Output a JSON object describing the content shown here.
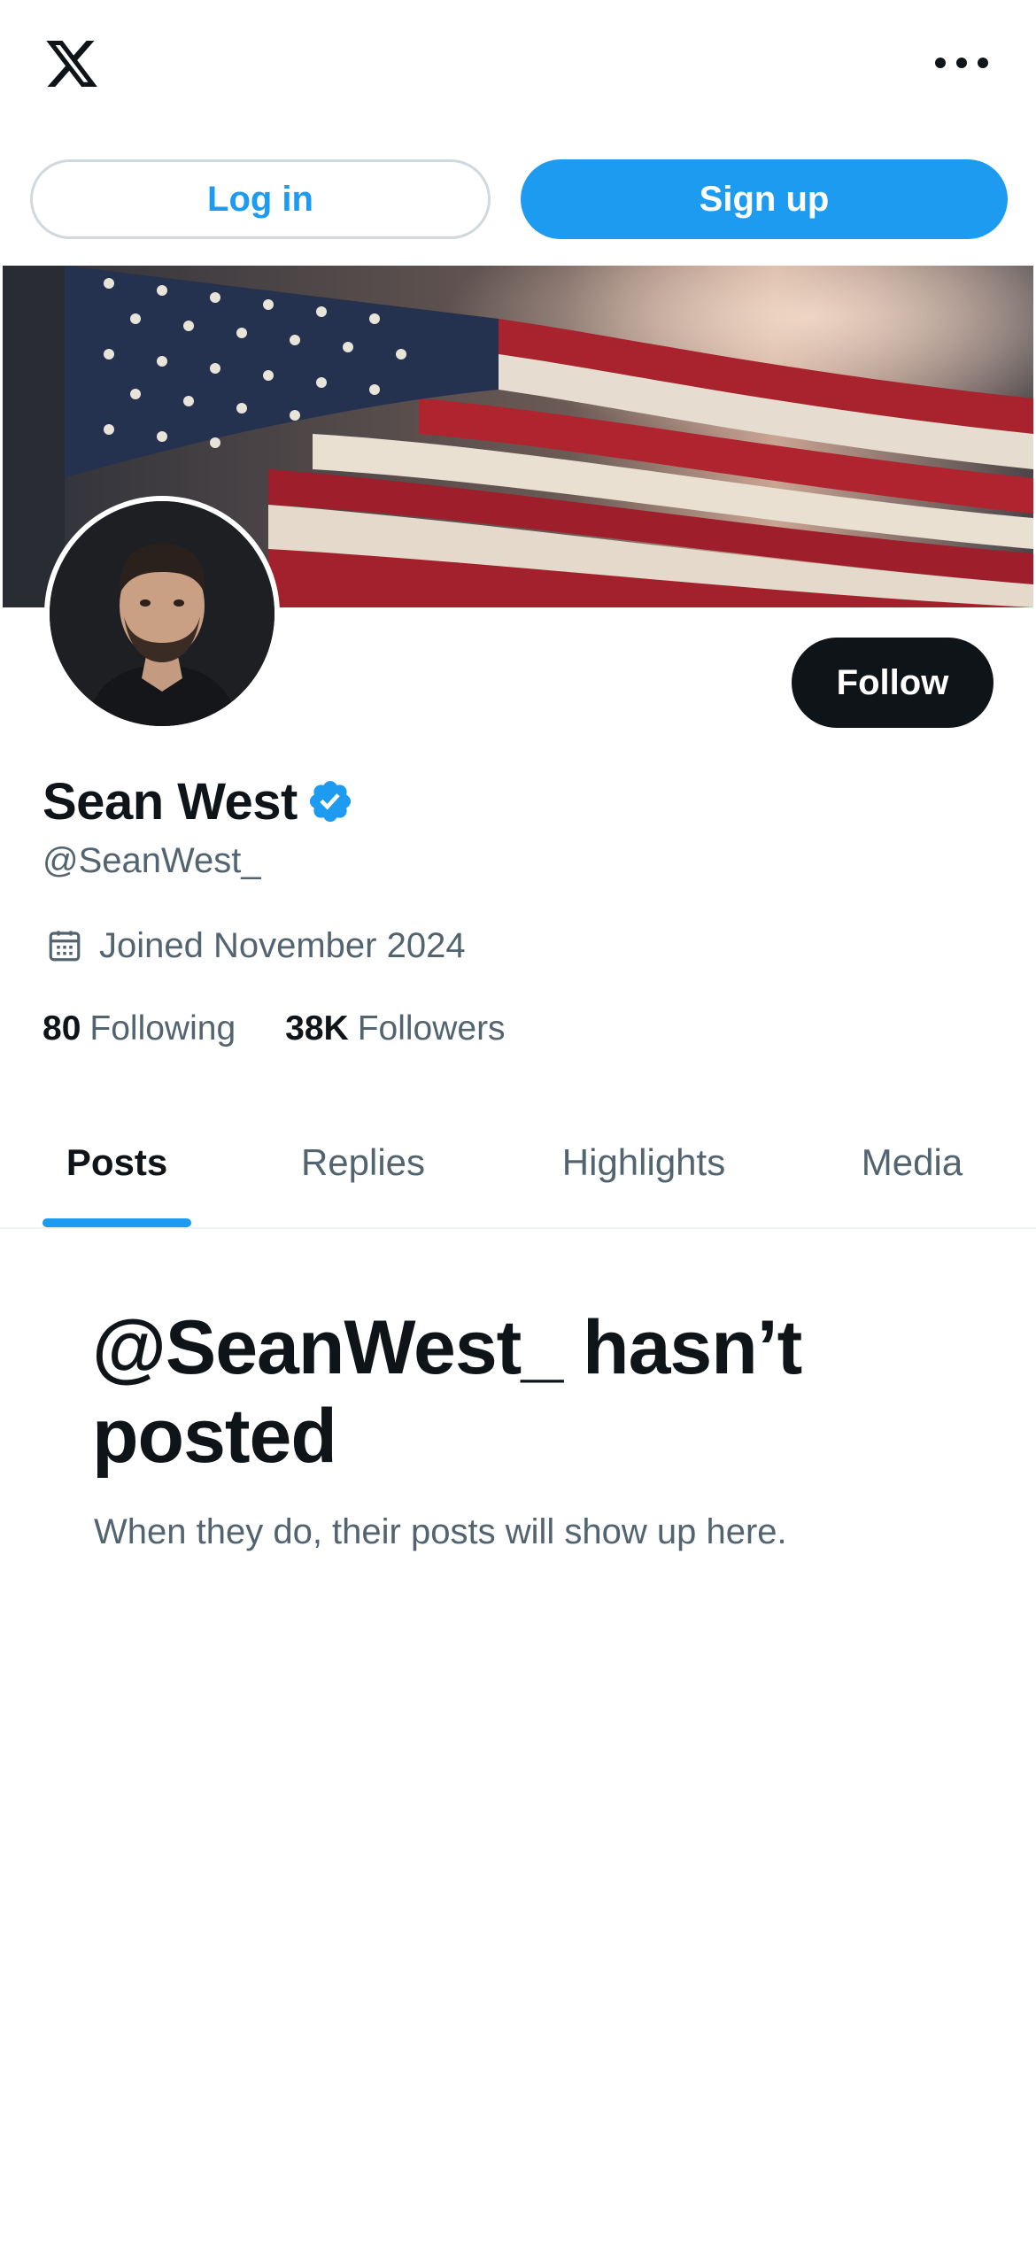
{
  "topbar": {
    "logo_icon": "x-logo-icon",
    "more_icon": "more-horizontal-icon"
  },
  "auth": {
    "login_label": "Log in",
    "signup_label": "Sign up"
  },
  "profile": {
    "banner_image": "american-flag-banner",
    "avatar_image": "profile-photo",
    "follow_label": "Follow",
    "display_name": "Sean West",
    "verified": true,
    "handle": "@SeanWest_",
    "joined": "Joined November 2024",
    "following_count": "80",
    "following_label": "Following",
    "followers_count": "38K",
    "followers_label": "Followers"
  },
  "tabs": [
    {
      "label": "Posts",
      "active": true
    },
    {
      "label": "Replies",
      "active": false
    },
    {
      "label": "Highlights",
      "active": false
    },
    {
      "label": "Media",
      "active": false
    }
  ],
  "empty_state": {
    "title": "@SeanWest_ hasn’t posted",
    "subtitle": "When they do, their posts will show up here."
  },
  "colors": {
    "accent": "#1d9bf0",
    "text_primary": "#0f1419",
    "text_secondary": "#536471",
    "divider": "#eff3f4"
  }
}
